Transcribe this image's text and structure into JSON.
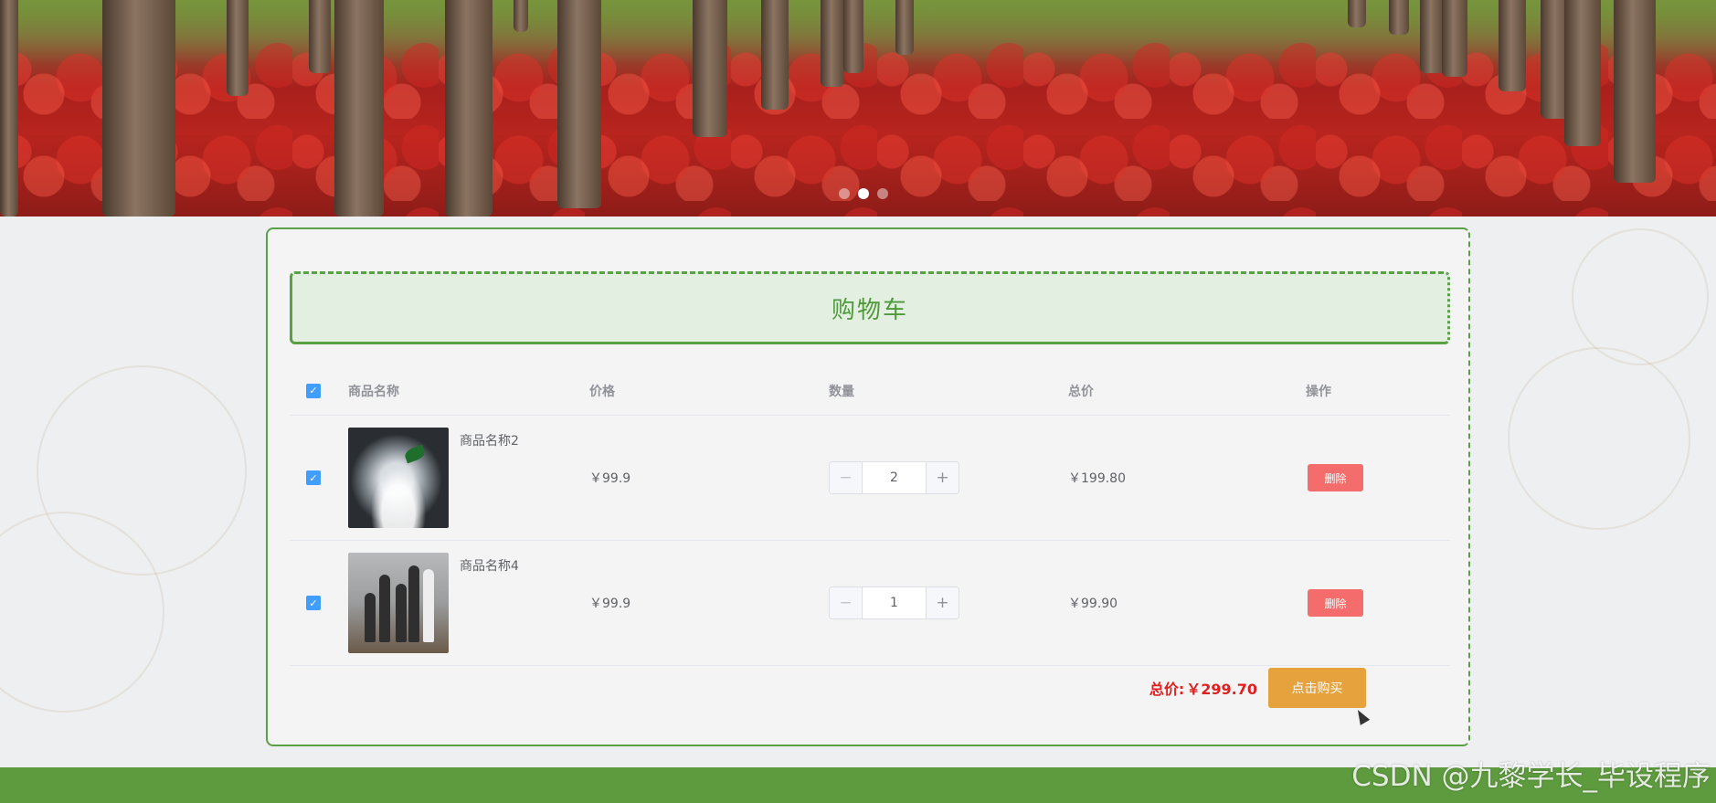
{
  "banner": {
    "dots": [
      {
        "active": false
      },
      {
        "active": true
      },
      {
        "active": false
      }
    ]
  },
  "cart": {
    "title": "购物车",
    "columns": {
      "name": "商品名称",
      "price": "价格",
      "quantity": "数量",
      "total": "总价",
      "action": "操作"
    },
    "items": [
      {
        "name": "商品名称2",
        "price": "￥99.9",
        "quantity": "2",
        "subtotal": "￥199.80",
        "delete_label": "删除",
        "image_icon": "crystal-apple-image",
        "checked": true
      },
      {
        "name": "商品名称4",
        "price": "￥99.9",
        "quantity": "1",
        "subtotal": "￥99.90",
        "delete_label": "删除",
        "image_icon": "statue-figures-image",
        "checked": true
      }
    ],
    "total_label": "总价:",
    "total_value": "￥299.70",
    "buy_label": "点击购买",
    "minus_glyph": "−",
    "plus_glyph": "+",
    "check_glyph": "✓"
  },
  "watermark": "CSDN @九黎学长_毕设程序",
  "colors": {
    "accent_green": "#5aa046",
    "header_bg": "#e3efe0",
    "checkbox_blue": "#409eff",
    "delete_red": "#f56c6c",
    "buy_orange": "#e6a23c",
    "total_red": "#e02020",
    "bottom_bar": "#5e9a3e"
  }
}
